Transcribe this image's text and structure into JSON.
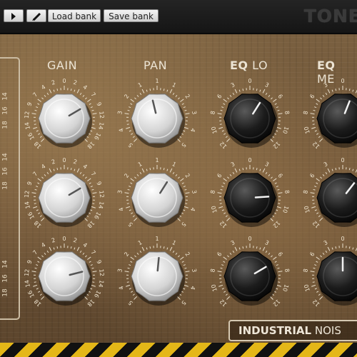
{
  "toolbar": {
    "play_icon": "play-icon",
    "edit_icon": "pencil-icon",
    "load_label": "Load bank",
    "save_label": "Save bank",
    "brand": "TONE"
  },
  "columns": [
    {
      "prefix": "",
      "label": "GAIN"
    },
    {
      "prefix": "",
      "label": "PAN"
    },
    {
      "prefix": "EQ",
      "label": " LO"
    },
    {
      "prefix": "EQ",
      "label": " ME"
    }
  ],
  "knob_scales": {
    "silver": [
      "18",
      "16",
      "14",
      "12",
      "9",
      "7",
      "4",
      "2",
      "0",
      "2",
      "4",
      "7",
      "9",
      "12",
      "14",
      "16",
      "18"
    ],
    "pan": [
      "5",
      "4",
      "3",
      "2",
      "1",
      "1",
      "1",
      "2",
      "3",
      "4",
      "5"
    ],
    "eq": [
      "12",
      "10",
      "8",
      "6",
      "3",
      "0",
      "3",
      "6",
      "8",
      "10",
      "12"
    ]
  },
  "left_scale": [
    "14",
    "16",
    "18"
  ],
  "rows": [
    {
      "gain": 0.72,
      "pan": 0.45,
      "eq_lo": 0.62,
      "eq_me": 0.58
    },
    {
      "gain": 0.72,
      "pan": 0.62,
      "eq_lo": 0.82,
      "eq_me": 0.64
    },
    {
      "gain": 0.78,
      "pan": 0.52,
      "eq_lo": 0.72,
      "eq_me": 0.5
    }
  ],
  "preset": {
    "prefix": "INDUSTRIAL",
    "label": " NOIS"
  },
  "colors": {
    "hazard_yellow": "#e4b718",
    "knob_silver": "#d8d8d8",
    "knob_black": "#1a1a1a"
  }
}
